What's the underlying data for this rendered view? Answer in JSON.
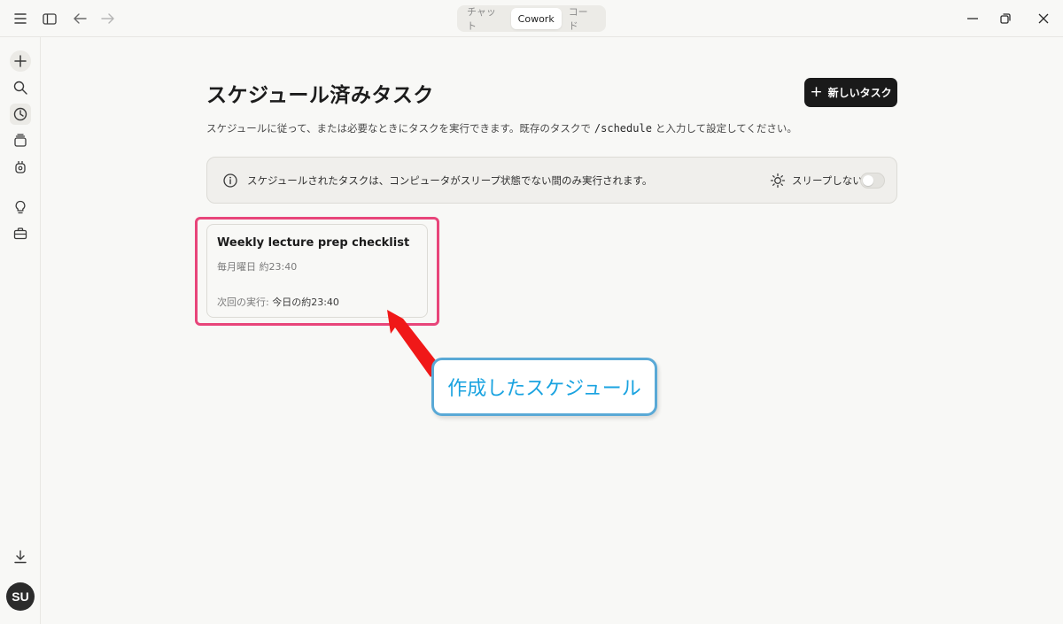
{
  "titlebar": {
    "tabs": [
      {
        "label": "チャット",
        "active": false
      },
      {
        "label": "Cowork",
        "active": true
      },
      {
        "label": "コード",
        "active": false
      }
    ]
  },
  "sidebar": {
    "items": [
      {
        "icon": "plus-icon"
      },
      {
        "icon": "search-icon"
      },
      {
        "icon": "clock-icon",
        "selected": true
      },
      {
        "icon": "layers-icon"
      },
      {
        "icon": "robot-icon"
      },
      {
        "icon": "lightbulb-icon"
      },
      {
        "icon": "briefcase-icon"
      }
    ],
    "download_icon": "download-icon",
    "avatar": "SU"
  },
  "main": {
    "title": "スケジュール済みタスク",
    "new_task_label": "新しいタスク",
    "subtitle_before": "スケジュールに従って、または必要なときにタスクを実行できます。既存のタスクで",
    "subtitle_code": "/schedule",
    "subtitle_after": "と入力して設定してください。",
    "info_text": "スケジュールされたタスクは、コンピュータがスリープ状態でない間のみ実行されます。",
    "sleep_label": "スリープしない",
    "sleep_toggle_on": false
  },
  "task": {
    "title": "Weekly lecture prep checklist",
    "schedule": "毎月曜日 約23:40",
    "next_label": "次回の実行: ",
    "next_value": "今日の約23:40"
  },
  "annotation": {
    "callout": "作成したスケジュール",
    "highlight_color": "#e8457a",
    "callout_border": "#5aa9d6",
    "callout_text_color": "#1aa3e0"
  }
}
